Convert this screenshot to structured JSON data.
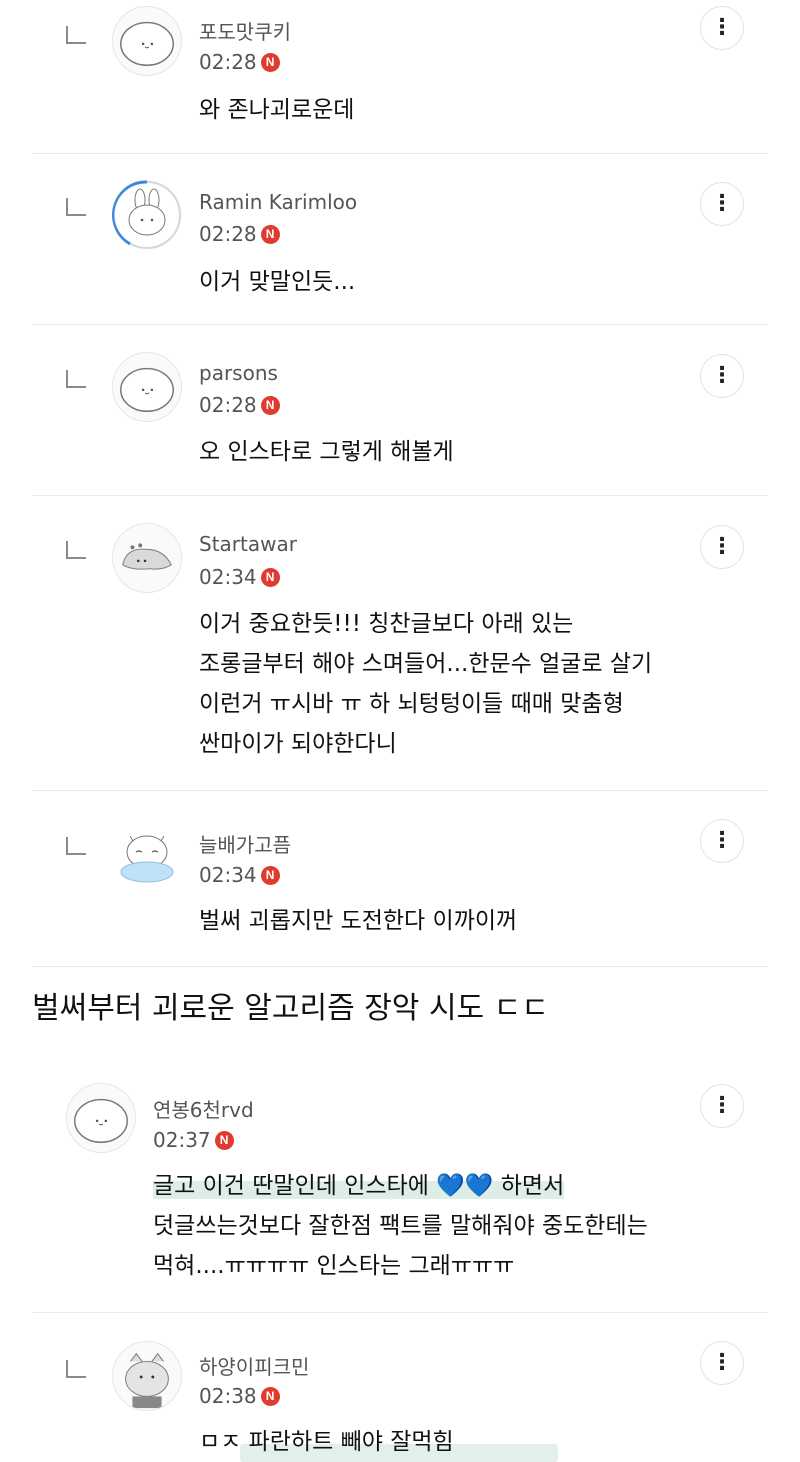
{
  "comments": [
    {
      "name": "포도맛쿠키",
      "time": "02:28",
      "badge": "N",
      "lines": [
        "와 존나괴로운데"
      ]
    },
    {
      "name": "Ramin Karimloo",
      "time": "02:28",
      "badge": "N",
      "lines": [
        "이거 맞말인듯..."
      ]
    },
    {
      "name": "parsons",
      "time": "02:28",
      "badge": "N",
      "lines": [
        "오 인스타로 그렇게 해볼게"
      ]
    },
    {
      "name": "Startawar",
      "time": "02:34",
      "badge": "N",
      "lines": [
        "이거 중요한듯!!! 칭찬글보다 아래 있는",
        "조롱글부터 해야 스며들어...한문수 얼굴로 살기",
        "이런거 ㅠ시바 ㅠ 하 뇌텅텅이들 때매 맞춤형",
        "싼마이가 되야한다니"
      ]
    },
    {
      "name": "늘배가고픔",
      "time": "02:34",
      "badge": "N",
      "lines": [
        "벌써 괴롭지만 도전한다 이까이꺼"
      ]
    },
    {
      "name": "연봉6천rvd",
      "time": "02:37",
      "badge": "N",
      "line1_a": "글고 이건 딴말인데 인스타에 ",
      "line1_hearts": "💙💙",
      "line1_b": " 하면서",
      "lines": [
        "덧글쓰는것보다 잘한점 팩트를 말해줘야 중도한테는",
        "먹혀....ㅠㅠㅠㅠ 인스타는 그래ㅠㅠㅠ"
      ]
    },
    {
      "name": "하양이피크민",
      "time": "02:38",
      "badge": "N",
      "lines": [
        "ㅁㅈ 파란하트 빼야 잘먹힘"
      ]
    }
  ],
  "caption": "벌써부터 괴로운 알고리즘 장악 시도 ㄷㄷ",
  "more_glyph": "⋮",
  "colors": {
    "badge": "#e03b2f",
    "highlight": "#dceee6",
    "heart": "#3a8fd8"
  }
}
